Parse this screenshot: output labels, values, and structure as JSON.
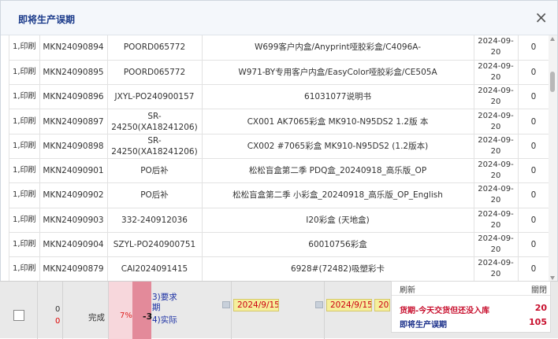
{
  "dialog": {
    "title": "即将生产误期",
    "close_icon": "×"
  },
  "rows": [
    {
      "qty": "1,印刷",
      "code": "MKN24090894",
      "po": "POORD065772",
      "product": "W699客户内盒/Anyprint哑胶彩盒/C4096A-",
      "date": "2024-09-20",
      "num": "0"
    },
    {
      "qty": "1,印刷",
      "code": "MKN24090895",
      "po": "POORD065772",
      "product": "W971-BY专用客户内盒/EasyColor哑胶彩盒/CE505A",
      "date": "2024-09-20",
      "num": "0"
    },
    {
      "qty": "1,印刷",
      "code": "MKN24090896",
      "po": "JXYL-PO240900157",
      "product": "61031077说明书",
      "date": "2024-09-20",
      "num": "0"
    },
    {
      "qty": "1,印刷",
      "code": "MKN24090897",
      "po": "SR-24250(XA18241206)",
      "product": "CX001 AK7065彩盒 MK910-N95DS2 1.2版 本",
      "date": "2024-09-20",
      "num": "0"
    },
    {
      "qty": "1,印刷",
      "code": "MKN24090898",
      "po": "SR-24250(XA18241206)",
      "product": "CX002 #7065彩盒 MK910-N95DS2 (1.2版本)",
      "date": "2024-09-20",
      "num": "0"
    },
    {
      "qty": "1,印刷",
      "code": "MKN24090901",
      "po": "PO后补",
      "product": "松松盲盒第二季 PDQ盒_20240918_高乐版_OP",
      "date": "2024-09-20",
      "num": "0"
    },
    {
      "qty": "1,印刷",
      "code": "MKN24090902",
      "po": "PO后补",
      "product": "松松盲盒第二季 小彩盒_20240918_高乐版_OP_English",
      "date": "2024-09-20",
      "num": "0"
    },
    {
      "qty": "1,印刷",
      "code": "MKN24090903",
      "po": "332-240912036",
      "product": "I20彩盒 (天地盒)",
      "date": "2024-09-20",
      "num": "0"
    },
    {
      "qty": "1,印刷",
      "code": "MKN24090904",
      "po": "SZYL-PO240900751",
      "product": "60010756彩盒",
      "date": "2024-09-20",
      "num": "0"
    },
    {
      "qty": "1,印刷",
      "code": "MKN24090879",
      "po": "CAI2024091415",
      "product": "6928#(72482)吸塑彩卡",
      "date": "2024-09-20",
      "num": "0"
    }
  ],
  "bottom_row": {
    "num_a": "0",
    "num_b": "0",
    "status": "完成",
    "percent": "7%",
    "delta": "-3",
    "required_label": "3)要求期",
    "actual_label": "4)实际",
    "date1": "2024/9/15",
    "date2": "2024/9/15",
    "date3": "20"
  },
  "notice": {
    "refresh_label": "刷新",
    "close_label": "關閉",
    "item1_label": "货期-今天交货但还没入库",
    "item1_value": "20",
    "item2_label": "即将生产误期",
    "item2_value": "105"
  },
  "colors": {
    "title_blue": "#1a3a8a",
    "red_text": "#c8102e",
    "date_highlight": "#f6ef9c",
    "red_cell": "#e38a9a"
  }
}
